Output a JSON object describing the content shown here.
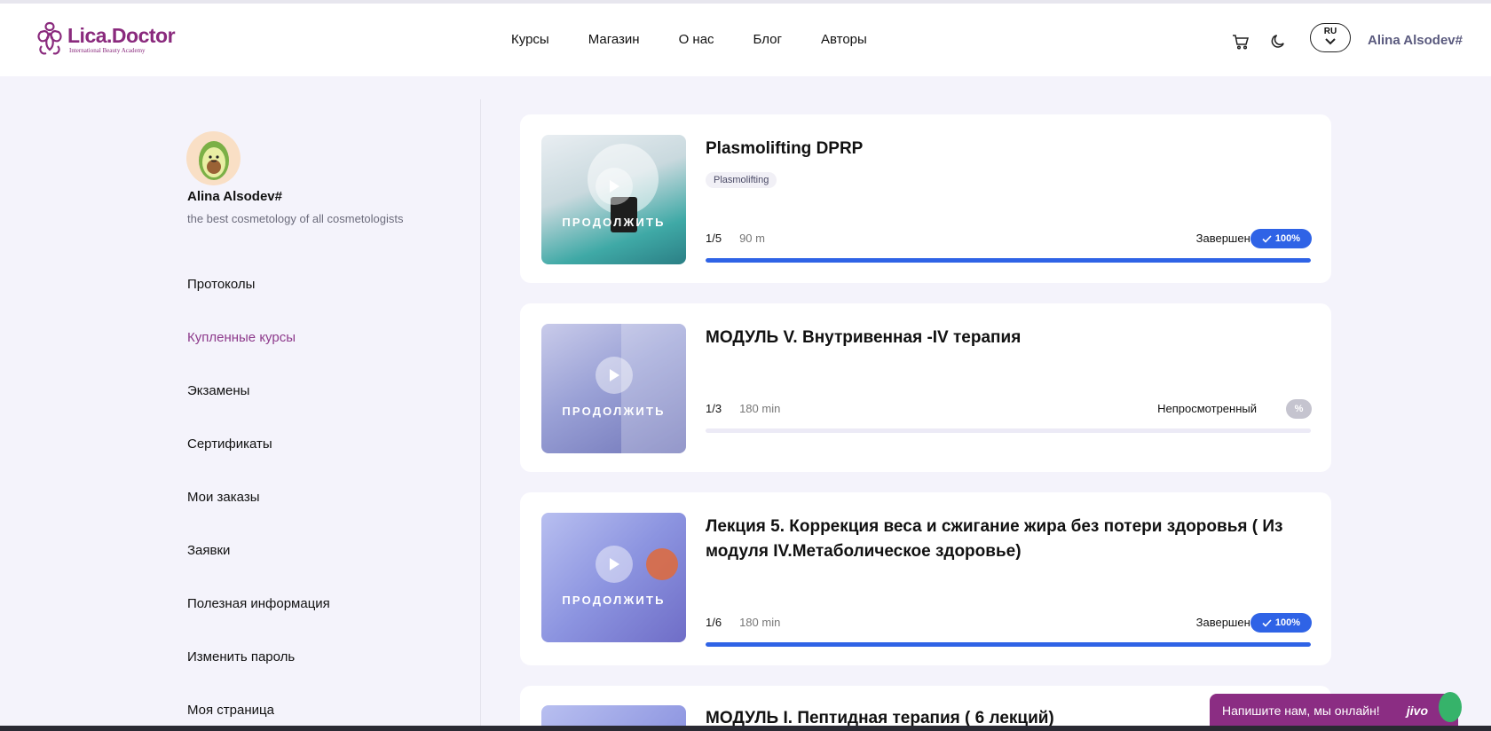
{
  "header": {
    "logo_name": "Lica.Doctor",
    "logo_sub": "International Beauty Academy",
    "nav": [
      "Курсы",
      "Магазин",
      "О нас",
      "Блог",
      "Авторы"
    ],
    "lang": "RU",
    "user": "Alina Alsodev#"
  },
  "profile": {
    "name": "Alina Alsodev#",
    "bio": "the best cosmetology of all cosmetologists"
  },
  "menu": [
    "Протоколы",
    "Купленные курсы",
    "Экзамены",
    "Сертификаты",
    "Мои заказы",
    "Заявки",
    "Полезная информация",
    "Изменить пароль",
    "Моя страница"
  ],
  "active_menu": "Купленные курсы",
  "courses": [
    {
      "title": "Plasmolifting DPRP",
      "tag": "Plasmolifting",
      "lessons": "1/5",
      "duration": "90 m",
      "status": "Завершено",
      "badge": "100%",
      "progress": 1.0,
      "continue": "ПРОДОЛЖИТЬ"
    },
    {
      "title": "МОДУЛЬ V. Внутривенная -IV терапия",
      "tag": "",
      "lessons": "1/3",
      "duration": "180 min",
      "status": "Непросмотренный",
      "badge": "%",
      "progress": 0.0,
      "continue": "ПРОДОЛЖИТЬ"
    },
    {
      "title": "Лекция 5. Коррекция веса и сжигание жира без потери здоровья ( Из модуля IV.Метаболическое здоровье)",
      "tag": "",
      "lessons": "1/6",
      "duration": "180 min",
      "status": "Завершено",
      "badge": "100%",
      "progress": 1.0,
      "continue": "ПРОДОЛЖИТЬ"
    },
    {
      "title": "МОДУЛЬ I. Пептидная терапия ( 6 лекций)"
    }
  ],
  "chat": {
    "text": "Напишите нам, мы онлайн!",
    "brand": "jivo"
  },
  "colors": {
    "brand": "#8a2a7d",
    "accent": "#2f63e6",
    "active_menu": "#8e3b8c"
  }
}
